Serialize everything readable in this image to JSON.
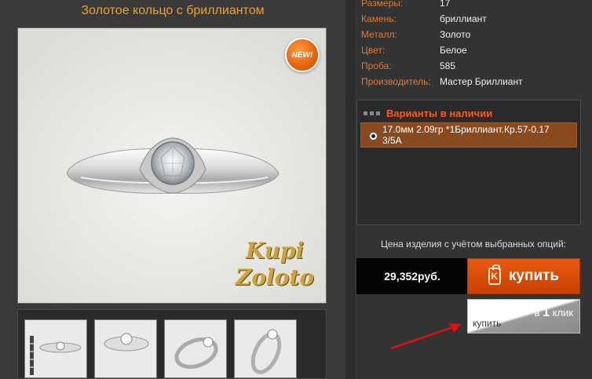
{
  "product": {
    "title": "Золотое кольцо с бриллиантом",
    "badge": "NEW!",
    "watermark_line1": "Kupi",
    "watermark_line2": "Zoloto"
  },
  "specs": [
    {
      "label": "Размеры:",
      "value": "17"
    },
    {
      "label": "Камень:",
      "value": "бриллиант"
    },
    {
      "label": "Металл:",
      "value": "Золото"
    },
    {
      "label": "Цвет:",
      "value": "Белое"
    },
    {
      "label": "Проба:",
      "value": "585"
    },
    {
      "label": "Производитель:",
      "value": "Мастер Бриллиант"
    }
  ],
  "variants": {
    "title": "Варианты в наличии",
    "items": [
      {
        "label": "17.0мм 2.09гр *1Бриллиант.Кр.57-0.17 3/5А",
        "selected": true
      }
    ]
  },
  "purchase": {
    "price_caption": "Цена изделия с учётом выбранных опций:",
    "price": "29,352руб.",
    "buy_label": "купить",
    "buy_icon_letter": "K",
    "oneclick_buy": "купить",
    "oneclick_prefix": "в",
    "oneclick_number": "1",
    "oneclick_suffix": "клик"
  },
  "colors": {
    "title": "#f0a030",
    "label": "#e07a30",
    "buy_button": "#e05010",
    "arrow": "#e01010"
  }
}
